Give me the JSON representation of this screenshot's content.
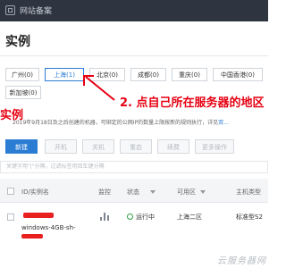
{
  "topbar": {
    "label": "网站备案"
  },
  "page_title": "实例",
  "regions": [
    {
      "label": "广州(0)"
    },
    {
      "label": "上海(1)",
      "active": true
    },
    {
      "label": "北京(0)"
    },
    {
      "label": "成都(0)"
    },
    {
      "label": "重庆(0)"
    },
    {
      "label": "中国香港(0)"
    },
    {
      "label": "新加坡(0)"
    }
  ],
  "annotation": {
    "main": "2. 点自己所在服务器的地区",
    "side": "实例",
    "color": "#e60012"
  },
  "notice": {
    "text": "2019年9月18日及之后创建的机器，可绑定的公网IP的数量上限按新的规则执行，详见",
    "link": "双..."
  },
  "toolbar": {
    "new_label": "新建",
    "start_label": "开机",
    "shutdown_label": "关机",
    "restart_label": "重启",
    "renew_label": "续费",
    "more_label": "更多操作"
  },
  "search": {
    "placeholder": "关键字用\"|\"分隔，过滤标签用回车键分隔"
  },
  "table": {
    "headers": {
      "id_name": "ID/实例名",
      "monitor": "监控",
      "status": "状态",
      "zone": "可用区",
      "model": "主机类型"
    },
    "rows": [
      {
        "name": "windows-4GB-sh-",
        "status": "运行中",
        "zone": "上海二区",
        "model": "标准型S2"
      }
    ]
  },
  "watermark": "云服务器网",
  "colors": {
    "accent": "#2b7cd3",
    "topbar": "#2f3540",
    "running": "#2ea043"
  }
}
